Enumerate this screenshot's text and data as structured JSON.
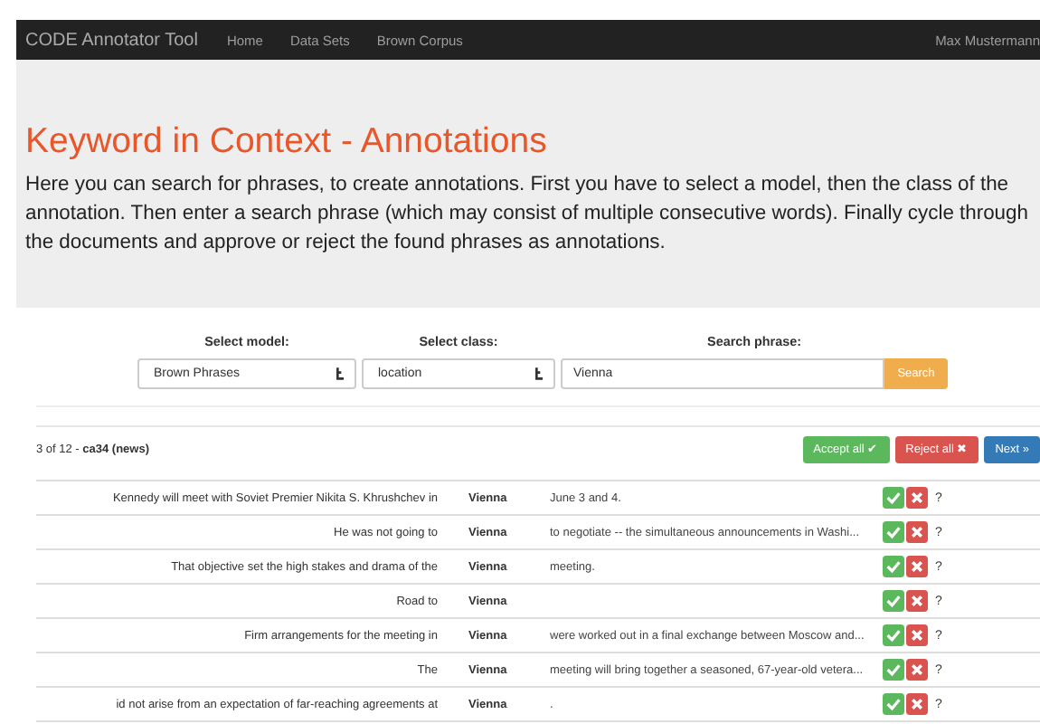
{
  "navbar": {
    "brand": "CODE Annotator Tool",
    "links": [
      "Home",
      "Data Sets",
      "Brown Corpus"
    ],
    "user": "Max Mustermann"
  },
  "header": {
    "title": "Keyword in Context - Annotations",
    "text": "Here you can search for phrases, to create annotations. First you have to select a model, then the class of the annotation. Then enter a search phrase (which may consist of multiple consecutive words). Finally cycle through the documents and approve or reject the found phrases as annotations."
  },
  "form": {
    "model": {
      "label": "Select model:",
      "value": "Brown Phrases"
    },
    "class": {
      "label": "Select class:",
      "value": "location"
    },
    "search": {
      "label": "Search phrase:",
      "value": "Vienna",
      "button": "Search"
    }
  },
  "results": {
    "position": "3 of 12 - ",
    "document": "ca34 (news)",
    "buttons": [
      {
        "label": "Accept all ✔",
        "kind": "accept"
      },
      {
        "label": "Reject all ✖",
        "kind": "reject"
      },
      {
        "label": "Next »",
        "kind": "next"
      }
    ]
  },
  "rows": [
    {
      "left": "Kennedy will meet with Soviet Premier Nikita S. Khrushchev in",
      "keyword": "Vienna",
      "right": "June 3 and 4.",
      "status": "?"
    },
    {
      "left": "He was not going to",
      "keyword": "Vienna",
      "right": "to negotiate -- the simultaneous announcements in Washi...",
      "status": "?"
    },
    {
      "left": "That objective set the high stakes and drama of the",
      "keyword": "Vienna",
      "right": "meeting.",
      "status": "?"
    },
    {
      "left": "Road to",
      "keyword": "Vienna",
      "status": "?"
    },
    {
      "left": "Firm arrangements for the meeting in",
      "keyword": "Vienna",
      "right": "were worked out in a final exchange between Moscow and...",
      "status": "?"
    },
    {
      "left": "The",
      "keyword": "Vienna",
      "right": "meeting will bring together a seasoned, 67-year-old vetera...",
      "status": "?"
    },
    {
      "left": "id not arise from an expectation of far-reaching agreements at",
      "keyword": "Vienna",
      "right": ".",
      "status": "?"
    }
  ]
}
